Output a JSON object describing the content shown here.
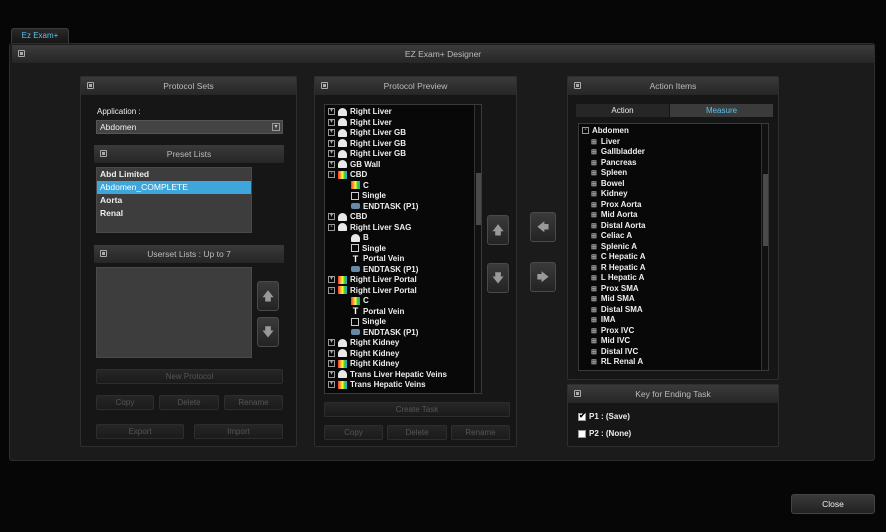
{
  "tab": "Ez Exam+",
  "window_title": "EZ Exam+ Designer",
  "protocol_sets": {
    "header": "Protocol Sets",
    "application_label": "Application :",
    "application_value": "Abdomen",
    "preset_header": "Preset Lists",
    "preset_items": [
      "Abd Limited",
      "Abdomen_COMPLETE",
      "Aorta",
      "Renal"
    ],
    "selected_preset": "Abdomen_COMPLETE",
    "userset_header": "Userset Lists : Up to 7",
    "new_protocol": "New Protocol",
    "copy": "Copy",
    "delete": "Delete",
    "rename": "Rename",
    "export": "Export",
    "import": "Import"
  },
  "protocol_preview": {
    "header": "Protocol Preview",
    "create_task": "Create Task",
    "copy": "Copy",
    "delete": "Delete",
    "rename": "Rename",
    "rows": [
      {
        "level": 0,
        "expand": "+",
        "icon": "probe",
        "label": "Right Liver"
      },
      {
        "level": 0,
        "expand": "+",
        "icon": "probe",
        "label": "Right Liver"
      },
      {
        "level": 0,
        "expand": "+",
        "icon": "probe",
        "label": "Right Liver GB"
      },
      {
        "level": 0,
        "expand": "+",
        "icon": "probe",
        "label": "Right Liver GB"
      },
      {
        "level": 0,
        "expand": "+",
        "icon": "probe",
        "label": "Right Liver GB"
      },
      {
        "level": 0,
        "expand": "+",
        "icon": "probe",
        "label": "GB Wall"
      },
      {
        "level": 0,
        "expand": "-",
        "icon": "color",
        "label": "CBD"
      },
      {
        "level": 1,
        "expand": "",
        "icon": "color",
        "label": "C"
      },
      {
        "level": 1,
        "expand": "",
        "icon": "check",
        "label": "Single"
      },
      {
        "level": 1,
        "expand": "",
        "icon": "endtask",
        "label": "ENDTASK (P1)"
      },
      {
        "level": 0,
        "expand": "+",
        "icon": "probe",
        "label": "CBD"
      },
      {
        "level": 0,
        "expand": "-",
        "icon": "probe",
        "label": "Right Liver SAG"
      },
      {
        "level": 1,
        "expand": "",
        "icon": "probe",
        "label": "B"
      },
      {
        "level": 1,
        "expand": "",
        "icon": "check",
        "label": "Single"
      },
      {
        "level": 1,
        "expand": "",
        "icon": "text",
        "label": "Portal Vein"
      },
      {
        "level": 1,
        "expand": "",
        "icon": "endtask",
        "label": "ENDTASK (P1)"
      },
      {
        "level": 0,
        "expand": "+",
        "icon": "color",
        "label": "Right Liver Portal"
      },
      {
        "level": 0,
        "expand": "-",
        "icon": "color",
        "label": "Right Liver Portal"
      },
      {
        "level": 1,
        "expand": "",
        "icon": "color",
        "label": "C"
      },
      {
        "level": 1,
        "expand": "",
        "icon": "text",
        "label": "Portal Vein"
      },
      {
        "level": 1,
        "expand": "",
        "icon": "check",
        "label": "Single"
      },
      {
        "level": 1,
        "expand": "",
        "icon": "endtask",
        "label": "ENDTASK (P1)"
      },
      {
        "level": 0,
        "expand": "+",
        "icon": "probe",
        "label": "Right Kidney"
      },
      {
        "level": 0,
        "expand": "+",
        "icon": "probe",
        "label": "Right Kidney"
      },
      {
        "level": 0,
        "expand": "+",
        "icon": "color",
        "label": "Right Kidney"
      },
      {
        "level": 0,
        "expand": "+",
        "icon": "probe",
        "label": "Trans Liver Hepatic Veins"
      },
      {
        "level": 0,
        "expand": "+",
        "icon": "color",
        "label": "Trans Hepatic Veins"
      }
    ]
  },
  "action_items": {
    "header": "Action Items",
    "tab_action": "Action",
    "tab_measure": "Measure",
    "active_tab": "Measure",
    "root": "Abdomen",
    "items": [
      "Liver",
      "Gallbladder",
      "Pancreas",
      "Spleen",
      "Bowel",
      "Kidney",
      "Prox Aorta",
      "Mid Aorta",
      "Distal Aorta",
      "Celiac A",
      "Splenic A",
      "C Hepatic A",
      "R Hepatic A",
      "L Hepatic A",
      "Prox SMA",
      "Mid SMA",
      "Distal SMA",
      "IMA",
      "Prox IVC",
      "Mid IVC",
      "Distal IVC",
      "RL Renal A"
    ]
  },
  "key_ending": {
    "header": "Key for Ending Task",
    "p1": "P1 : (Save)",
    "p1_checked": true,
    "p2": "P2 : (None)",
    "p2_checked": false
  },
  "close": "Close"
}
